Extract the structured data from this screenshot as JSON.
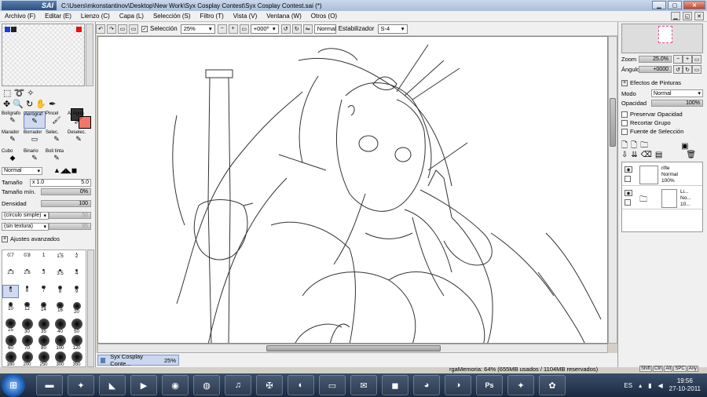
{
  "window": {
    "title": "C:\\Users\\mkonstantinov\\Desktop\\New Work\\Syx Cosplay Contest\\Syx Cosplay Contest.sai (*)",
    "logo": "SAI",
    "logo_small": "PaintTool"
  },
  "menu": [
    {
      "label": "Archivo (F)"
    },
    {
      "label": "Editar (E)"
    },
    {
      "label": "Lienzo (C)"
    },
    {
      "label": "Capa (L)"
    },
    {
      "label": "Selección (S)"
    },
    {
      "label": "Filtro (T)"
    },
    {
      "label": "Vista (V)"
    },
    {
      "label": "Ventana (W)"
    },
    {
      "label": "Otros (O)"
    }
  ],
  "toolbar": {
    "selection_label": "Selección",
    "zoom": "25%",
    "rotation": "+000º",
    "blend": "Normal",
    "stabilizer_label": "Estabilizador",
    "stabilizer_value": "S-4"
  },
  "tools": [
    {
      "label": "Bolígrafo",
      "glyph": "✎"
    },
    {
      "label": "Aerógraf",
      "glyph": "✎",
      "selected": true
    },
    {
      "label": "Pincel",
      "glyph": "🖌"
    },
    {
      "label": "Al Agua",
      "glyph": "🖌"
    },
    {
      "label": "Marador",
      "glyph": "✎"
    },
    {
      "label": "Borrador",
      "glyph": "▭"
    },
    {
      "label": "Selec.",
      "glyph": "✎"
    },
    {
      "label": "Deselec.",
      "glyph": "✎"
    },
    {
      "label": "Cubo",
      "glyph": "◆"
    },
    {
      "label": "Binario",
      "glyph": "✎"
    },
    {
      "label": "Boli tinta",
      "glyph": "✎"
    }
  ],
  "brush": {
    "mode": "Normal",
    "size_label": "Tamaño",
    "size_mult": "x 1.0",
    "size_value": "5.0",
    "min_size_label": "Tamaño mín.",
    "min_size_value": "0%",
    "density_label": "Densidad",
    "density_value": "100",
    "shape": "(círculo simple)",
    "shape_value": "50",
    "texture": "(sin textura)",
    "texture_value": "95",
    "advanced_label": "Ajustes avanzados"
  },
  "brush_sizes": [
    "0.7",
    "0.8",
    "1",
    "1.5",
    "2",
    "2.3",
    "2.6",
    "3",
    "3.5",
    "4",
    "5",
    "6",
    "7",
    "8",
    "9",
    "10",
    "12",
    "14",
    "16",
    "20",
    "25",
    "30",
    "35",
    "40",
    "50",
    "60",
    "70",
    "80",
    "100",
    "120",
    "160",
    "200",
    "250",
    "300",
    "350"
  ],
  "right_panel": {
    "zoom_label": "Zoom",
    "zoom_value": "25.0%",
    "angle_label": "Ángulo",
    "angle_value": "+0000",
    "effects_label": "Efectos de Pinturas",
    "mode_label": "Modo",
    "mode_value": "Normal",
    "opacity_label": "Opacidad",
    "opacity_value": "100%",
    "preserve_opacity": "Preservar Opacidad",
    "clip_group": "Recortar Grupo",
    "selection_source": "Fuente de Selección"
  },
  "layers": [
    {
      "name": "rifle",
      "mode": "Normal",
      "opacity": "100%"
    },
    {
      "name": "Li...",
      "mode": "No...",
      "opacity": "10..."
    }
  ],
  "doc_tab": {
    "name": "Syx Cosplay Conte...",
    "zoom": "25%"
  },
  "status": {
    "memory": "rgaMemoria: 64% (655MB usados / 1104MB reservados)",
    "keys": [
      "Shift",
      "Ctrl",
      "Alt",
      "SPC",
      "Any"
    ]
  },
  "taskbar": {
    "time": "19:56",
    "date": "27-10-2011",
    "language": "ES"
  },
  "colors": {
    "foreground": "#333333",
    "background": "#f07868",
    "selection_accent": "#cfd9ef"
  }
}
